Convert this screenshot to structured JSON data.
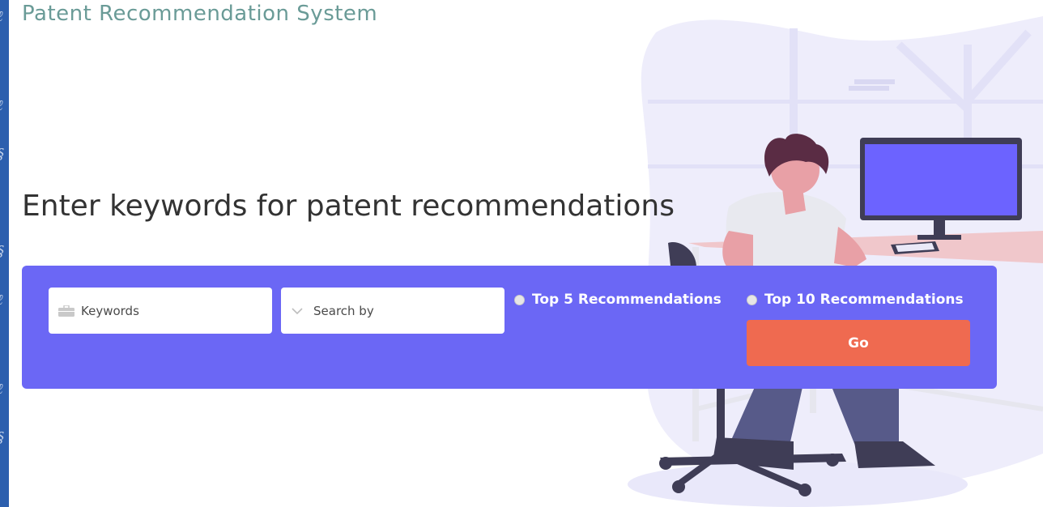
{
  "app": {
    "title": "Patent Recommendation System"
  },
  "hero": {
    "headline": "Enter keywords for patent recommendations"
  },
  "search": {
    "keywords_placeholder": "Keywords",
    "searchby_placeholder": "Search by",
    "options": [
      {
        "label": "Top 5 Recommendations",
        "selected": false
      },
      {
        "label": "Top 10 Recommendations",
        "selected": false
      }
    ],
    "go_label": "Go"
  },
  "icons": {
    "keywords": "briefcase-icon",
    "searchby": "chevron-down-icon"
  },
  "colors": {
    "panel": "#6b67f5",
    "go_button": "#ef6a50",
    "title": "#6a9b97",
    "illustration_accent": "#6c63ff"
  }
}
